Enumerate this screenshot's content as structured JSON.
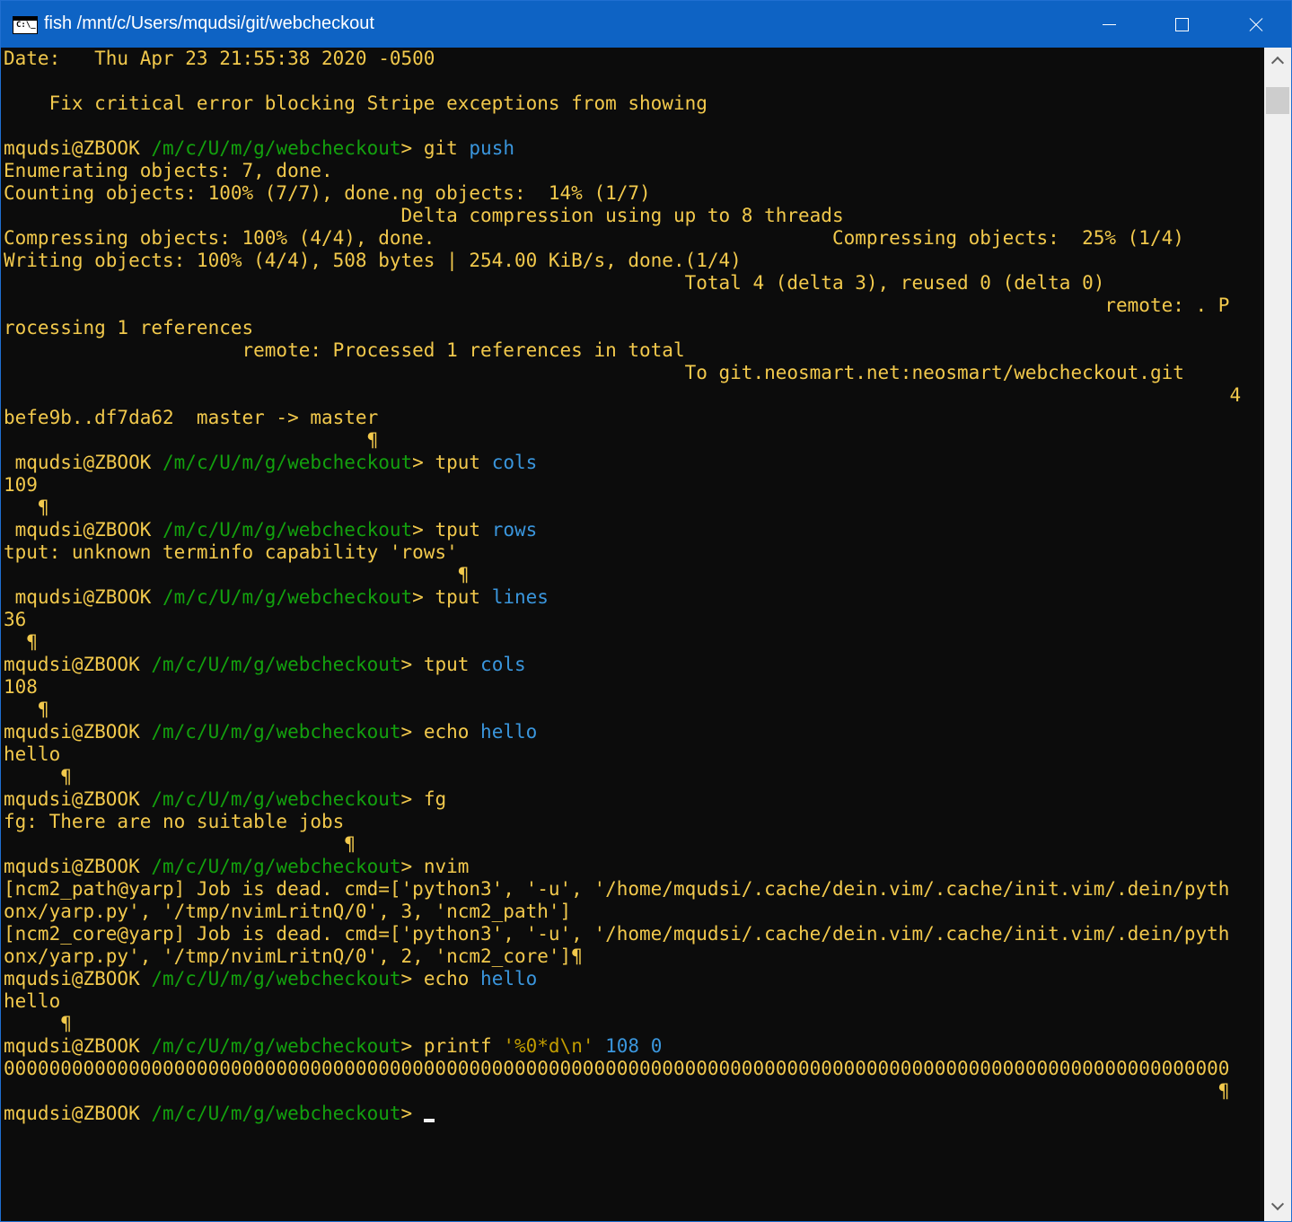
{
  "window": {
    "title": "fish /mnt/c/Users/mqudsi/git/webcheckout",
    "icon_label": "C:\\_"
  },
  "colors": {
    "titlebar": "#0e63c4",
    "background": "#0c0c0c",
    "user_text": "#f2c94c",
    "path": "#13a10e",
    "argument": "#3a96dd",
    "string": "#c19c00"
  },
  "prompt": {
    "user": "mqudsi@ZBOOK",
    "path": "/m/c/U/m/g/webcheckout",
    "sep": "> "
  },
  "terminal": {
    "lines": [
      {
        "segs": [
          {
            "t": "Date:   Thu Apr 23 21:55:38 2020 -0500",
            "c": "text"
          }
        ]
      },
      {
        "segs": []
      },
      {
        "segs": [
          {
            "t": "    Fix critical error blocking Stripe exceptions from showing",
            "c": "text"
          }
        ]
      },
      {
        "segs": []
      },
      {
        "segs": [
          {
            "t": "mqudsi@ZBOOK ",
            "c": "user"
          },
          {
            "t": "/m/c/U/m/g/webcheckout",
            "c": "path"
          },
          {
            "t": "> ",
            "c": "user"
          },
          {
            "t": "git ",
            "c": "text"
          },
          {
            "t": "push",
            "c": "arg"
          }
        ]
      },
      {
        "segs": [
          {
            "t": "Enumerating objects: 7, done.",
            "c": "text"
          }
        ]
      },
      {
        "segs": [
          {
            "t": "Counting objects: 100% (7/7), done.ng objects:  14% (1/7)",
            "c": "text"
          }
        ]
      },
      {
        "segs": [
          {
            "t": "                                   Delta compression using up to 8 threads",
            "c": "text"
          }
        ]
      },
      {
        "segs": [
          {
            "t": "Compressing objects: 100% (4/4), done.                                   Compressing objects:  25% (1/4)",
            "c": "text"
          }
        ]
      },
      {
        "segs": [
          {
            "t": "Writing objects: 100% (4/4), 508 bytes | 254.00 KiB/s, done.(1/4)",
            "c": "text"
          }
        ]
      },
      {
        "segs": [
          {
            "t": "                                                            Total 4 (delta 3), reused 0 (delta 0)",
            "c": "text"
          }
        ]
      },
      {
        "segs": [
          {
            "t": "                                                                                                 remote: . P",
            "c": "text"
          }
        ]
      },
      {
        "segs": [
          {
            "t": "rocessing 1 references",
            "c": "text"
          }
        ]
      },
      {
        "segs": [
          {
            "t": "                     remote: Processed 1 references in total",
            "c": "text"
          }
        ]
      },
      {
        "segs": [
          {
            "t": "                                                            To git.neosmart.net:neosmart/webcheckout.git",
            "c": "text"
          }
        ]
      },
      {
        "segs": [
          {
            "t": "                                                                                                            4",
            "c": "text"
          }
        ]
      },
      {
        "segs": [
          {
            "t": "befe9b..df7da62  master -> master",
            "c": "text"
          }
        ]
      },
      {
        "segs": [
          {
            "t": "                                ¶",
            "c": "text"
          }
        ]
      },
      {
        "segs": [
          {
            "t": " mqudsi@ZBOOK ",
            "c": "user"
          },
          {
            "t": "/m/c/U/m/g/webcheckout",
            "c": "path"
          },
          {
            "t": "> ",
            "c": "user"
          },
          {
            "t": "tput ",
            "c": "text"
          },
          {
            "t": "cols",
            "c": "arg"
          }
        ]
      },
      {
        "segs": [
          {
            "t": "109",
            "c": "text"
          }
        ]
      },
      {
        "segs": [
          {
            "t": "   ¶",
            "c": "text"
          }
        ]
      },
      {
        "segs": [
          {
            "t": " mqudsi@ZBOOK ",
            "c": "user"
          },
          {
            "t": "/m/c/U/m/g/webcheckout",
            "c": "path"
          },
          {
            "t": "> ",
            "c": "user"
          },
          {
            "t": "tput ",
            "c": "text"
          },
          {
            "t": "rows",
            "c": "arg"
          }
        ]
      },
      {
        "segs": [
          {
            "t": "tput: unknown terminfo capability 'rows'",
            "c": "text"
          }
        ]
      },
      {
        "segs": [
          {
            "t": "                                        ¶",
            "c": "text"
          }
        ]
      },
      {
        "segs": [
          {
            "t": " mqudsi@ZBOOK ",
            "c": "user"
          },
          {
            "t": "/m/c/U/m/g/webcheckout",
            "c": "path"
          },
          {
            "t": "> ",
            "c": "user"
          },
          {
            "t": "tput ",
            "c": "text"
          },
          {
            "t": "lines",
            "c": "arg"
          }
        ]
      },
      {
        "segs": [
          {
            "t": "36",
            "c": "text"
          }
        ]
      },
      {
        "segs": [
          {
            "t": "  ¶",
            "c": "text"
          }
        ]
      },
      {
        "segs": [
          {
            "t": "mqudsi@ZBOOK ",
            "c": "user"
          },
          {
            "t": "/m/c/U/m/g/webcheckout",
            "c": "path"
          },
          {
            "t": "> ",
            "c": "user"
          },
          {
            "t": "tput ",
            "c": "text"
          },
          {
            "t": "cols",
            "c": "arg"
          }
        ]
      },
      {
        "segs": [
          {
            "t": "108",
            "c": "text"
          }
        ]
      },
      {
        "segs": [
          {
            "t": "   ¶",
            "c": "text"
          }
        ]
      },
      {
        "segs": [
          {
            "t": "mqudsi@ZBOOK ",
            "c": "user"
          },
          {
            "t": "/m/c/U/m/g/webcheckout",
            "c": "path"
          },
          {
            "t": "> ",
            "c": "user"
          },
          {
            "t": "echo ",
            "c": "text"
          },
          {
            "t": "hello",
            "c": "arg"
          }
        ]
      },
      {
        "segs": [
          {
            "t": "hello",
            "c": "text"
          }
        ]
      },
      {
        "segs": [
          {
            "t": "     ¶",
            "c": "text"
          }
        ]
      },
      {
        "segs": [
          {
            "t": "mqudsi@ZBOOK ",
            "c": "user"
          },
          {
            "t": "/m/c/U/m/g/webcheckout",
            "c": "path"
          },
          {
            "t": "> ",
            "c": "user"
          },
          {
            "t": "fg",
            "c": "text"
          }
        ]
      },
      {
        "segs": [
          {
            "t": "fg: There are no suitable jobs",
            "c": "text"
          }
        ]
      },
      {
        "segs": [
          {
            "t": "                              ¶",
            "c": "text"
          }
        ]
      },
      {
        "segs": [
          {
            "t": "mqudsi@ZBOOK ",
            "c": "user"
          },
          {
            "t": "/m/c/U/m/g/webcheckout",
            "c": "path"
          },
          {
            "t": "> ",
            "c": "user"
          },
          {
            "t": "nvim",
            "c": "text"
          }
        ]
      },
      {
        "segs": [
          {
            "t": "[ncm2_path@yarp] Job is dead. cmd=['python3', '-u', '/home/mqudsi/.cache/dein.vim/.cache/init.vim/.dein/pyth",
            "c": "text"
          }
        ]
      },
      {
        "segs": [
          {
            "t": "onx/yarp.py', '/tmp/nvimLritnQ/0', 3, 'ncm2_path']",
            "c": "text"
          }
        ]
      },
      {
        "segs": [
          {
            "t": "[ncm2_core@yarp] Job is dead. cmd=['python3', '-u', '/home/mqudsi/.cache/dein.vim/.cache/init.vim/.dein/pyth",
            "c": "text"
          }
        ]
      },
      {
        "segs": [
          {
            "t": "onx/yarp.py', '/tmp/nvimLritnQ/0', 2, 'ncm2_core']¶",
            "c": "text"
          }
        ]
      },
      {
        "segs": [
          {
            "t": "mqudsi@ZBOOK ",
            "c": "user"
          },
          {
            "t": "/m/c/U/m/g/webcheckout",
            "c": "path"
          },
          {
            "t": "> ",
            "c": "user"
          },
          {
            "t": "echo ",
            "c": "text"
          },
          {
            "t": "hello",
            "c": "arg"
          }
        ]
      },
      {
        "segs": [
          {
            "t": "hello",
            "c": "text"
          }
        ]
      },
      {
        "segs": [
          {
            "t": "     ¶",
            "c": "text"
          }
        ]
      },
      {
        "segs": [
          {
            "t": "mqudsi@ZBOOK ",
            "c": "user"
          },
          {
            "t": "/m/c/U/m/g/webcheckout",
            "c": "path"
          },
          {
            "t": "> ",
            "c": "user"
          },
          {
            "t": "printf ",
            "c": "text"
          },
          {
            "t": "'%0*d\\n'",
            "c": "str"
          },
          {
            "t": " 108 0",
            "c": "arg"
          }
        ]
      },
      {
        "segs": [
          {
            "t": "000000000000000000000000000000000000000000000000000000000000000000000000000000000000000000000000000000000000",
            "c": "text"
          }
        ]
      },
      {
        "segs": [
          {
            "t": "                                                                                                           ¶",
            "c": "text"
          }
        ]
      },
      {
        "segs": [
          {
            "t": "mqudsi@ZBOOK ",
            "c": "user"
          },
          {
            "t": "/m/c/U/m/g/webcheckout",
            "c": "path"
          },
          {
            "t": "> ",
            "c": "user"
          }
        ],
        "cursor": true
      }
    ]
  }
}
